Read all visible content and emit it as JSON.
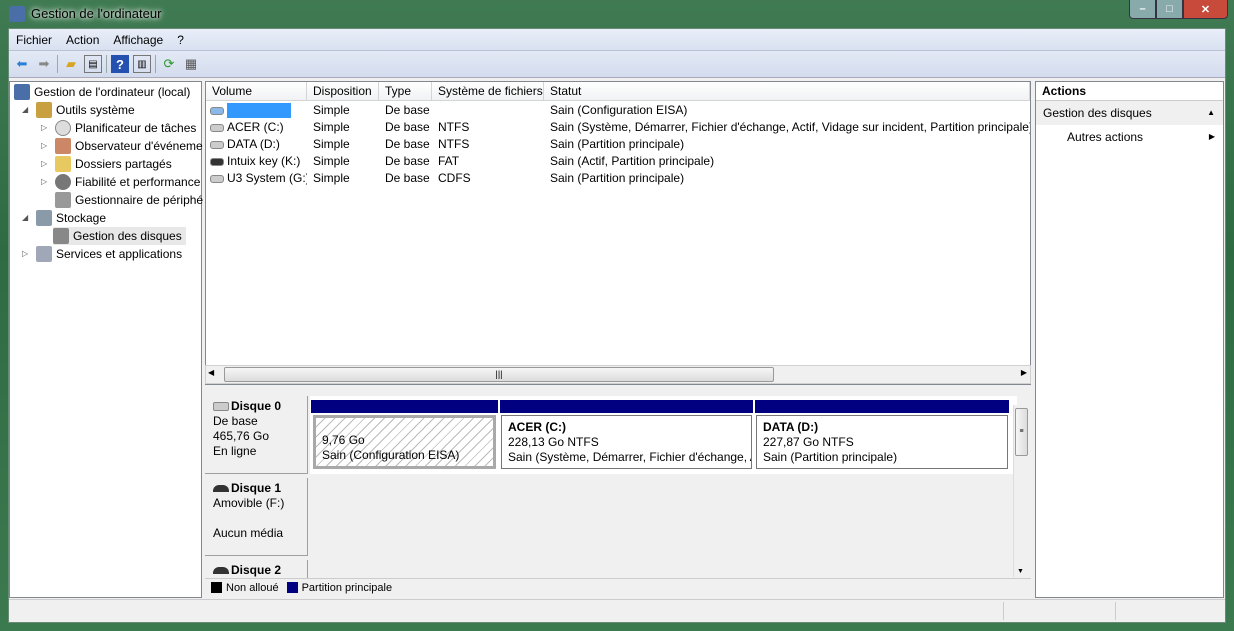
{
  "window": {
    "title": "Gestion de l'ordinateur"
  },
  "menu": [
    "Fichier",
    "Action",
    "Affichage",
    "?"
  ],
  "tree": {
    "root": "Gestion de l'ordinateur (local)",
    "system_tools": "Outils système",
    "items": [
      "Planificateur de tâches",
      "Observateur d'événeme",
      "Dossiers partagés",
      "Fiabilité et performance",
      "Gestionnaire de périphé"
    ],
    "storage": "Stockage",
    "disk_mgmt": "Gestion des disques",
    "services": "Services et applications"
  },
  "volumes": {
    "columns": [
      "Volume",
      "Disposition",
      "Type",
      "Système de fichiers",
      "Statut"
    ],
    "rows": [
      {
        "name": "",
        "layout": "Simple",
        "type": "De base",
        "fs": "",
        "status": "Sain (Configuration EISA)",
        "icon": "disk-icon"
      },
      {
        "name": "ACER (C:)",
        "layout": "Simple",
        "type": "De base",
        "fs": "NTFS",
        "status": "Sain (Système, Démarrer, Fichier d'échange, Actif, Vidage sur incident, Partition principale)",
        "icon": "disk-icon"
      },
      {
        "name": "DATA (D:)",
        "layout": "Simple",
        "type": "De base",
        "fs": "NTFS",
        "status": "Sain (Partition principale)",
        "icon": "disk-icon"
      },
      {
        "name": "Intuix key (K:)",
        "layout": "Simple",
        "type": "De base",
        "fs": "FAT",
        "status": "Sain (Actif, Partition principale)",
        "icon": "removable-icon"
      },
      {
        "name": "U3 System (G:)",
        "layout": "Simple",
        "type": "De base",
        "fs": "CDFS",
        "status": "Sain (Partition principale)",
        "icon": "cd-icon"
      }
    ]
  },
  "disks": [
    {
      "name": "Disque 0",
      "type": "De base",
      "size": "465,76 Go",
      "state": "En ligne",
      "partitions": [
        {
          "title": "",
          "size": "9,76 Go",
          "status": "Sain (Configuration EISA)"
        },
        {
          "title": "ACER  (C:)",
          "size": "228,13 Go NTFS",
          "status": "Sain (Système, Démarrer, Fichier d'échange, A"
        },
        {
          "title": "DATA  (D:)",
          "size": "227,87 Go NTFS",
          "status": "Sain (Partition principale)"
        }
      ]
    },
    {
      "name": "Disque 1",
      "type": "Amovible (F:)",
      "state": "Aucun média"
    },
    {
      "name": "Disque 2"
    }
  ],
  "legend": [
    {
      "label": "Non alloué",
      "color": "#000000"
    },
    {
      "label": "Partition principale",
      "color": "#000080"
    }
  ],
  "actions": {
    "title": "Actions",
    "section": "Gestion des disques",
    "item": "Autres actions"
  },
  "colors": {
    "partition_bar": "#000080",
    "selection": "#3399ff"
  }
}
